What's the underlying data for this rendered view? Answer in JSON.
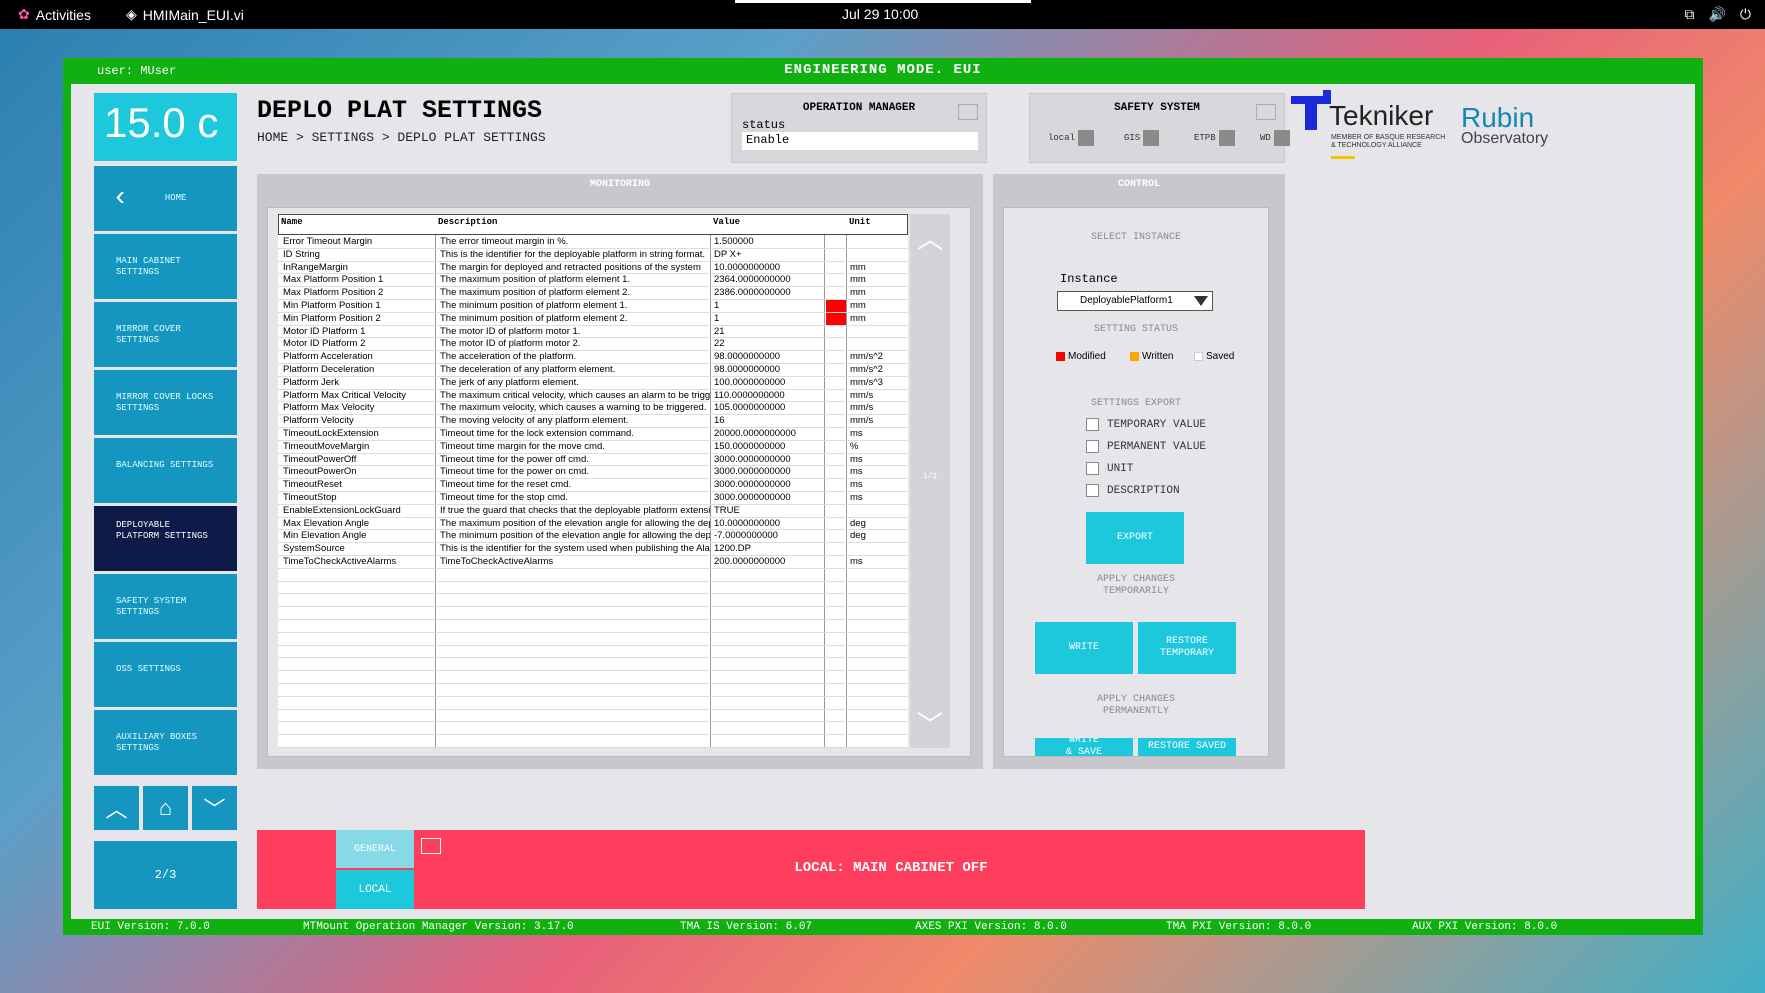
{
  "topbar": {
    "activities": "Activities",
    "app_name": "HMIMain_EUI.vi",
    "clock": "Jul 29  10:00"
  },
  "window": {
    "user": "user: MUser",
    "mode": "ENGINEERING MODE. EUI"
  },
  "sidebar": {
    "temperature": "15.0 c",
    "home_label": "HOME",
    "items": [
      {
        "label": "MAIN CABINET SETTINGS"
      },
      {
        "label": "MIRROR COVER SETTINGS"
      },
      {
        "label": "MIRROR COVER LOCKS SETTINGS"
      },
      {
        "label": "BALANCING SETTINGS"
      },
      {
        "label": "DEPLOYABLE PLATFORM SETTINGS"
      },
      {
        "label": "SAFETY SYSTEM SETTINGS"
      },
      {
        "label": "OSS SETTINGS"
      },
      {
        "label": "AUXILIARY BOXES SETTINGS"
      }
    ],
    "page": "2/3"
  },
  "page": {
    "title": "DEPLO PLAT SETTINGS",
    "breadcrumb": "HOME > SETTINGS > DEPLO PLAT SETTINGS"
  },
  "operation_manager": {
    "title": "OPERATION MANAGER",
    "status_label": "status",
    "status_value": "Enable"
  },
  "safety_system": {
    "title": "SAFETY SYSTEM",
    "indicators": [
      "local",
      "GIS",
      "ETPB",
      "WD"
    ]
  },
  "logos": {
    "tekniker": "Tekniker",
    "tekniker_sub": "MEMBER OF BASQUE RESEARCH & TECHNOLOGY ALLIANCE",
    "rubin_1": "Rubin",
    "rubin_2": "Observatory"
  },
  "monitoring": {
    "title": "MONITORING",
    "columns": [
      "Name",
      "Description",
      "Value",
      "Unit"
    ],
    "page": "1/1",
    "rows": [
      {
        "name": "Error Timeout Margin",
        "desc": "The error timeout margin in %.",
        "value": "1.500000",
        "unit": "",
        "modified": false
      },
      {
        "name": "ID String",
        "desc": "This is the identifier for the deployable platform in string format.",
        "value": "DP X+",
        "unit": "",
        "modified": false
      },
      {
        "name": "InRangeMargin",
        "desc": "The margin for deployed and retracted positions of the system",
        "value": "10.0000000000",
        "unit": "mm",
        "modified": false
      },
      {
        "name": "Max Platform Position 1",
        "desc": "The maximum position of platform element 1.",
        "value": "2364.0000000000",
        "unit": "mm",
        "modified": false
      },
      {
        "name": "Max Platform Position 2",
        "desc": "The maximum position of platform element 2.",
        "value": "2386.0000000000",
        "unit": "mm",
        "modified": false
      },
      {
        "name": "Min Platform Position 1",
        "desc": "The minimum position of platform element 1.",
        "value": "1",
        "unit": "mm",
        "modified": true
      },
      {
        "name": "Min Platform Position 2",
        "desc": "The minimum position of platform element 2.",
        "value": "1",
        "unit": "mm",
        "modified": true
      },
      {
        "name": "Motor ID Platform 1",
        "desc": "The motor ID of platform motor 1.",
        "value": "21",
        "unit": "",
        "modified": false
      },
      {
        "name": "Motor ID Platform 2",
        "desc": "The motor ID of platform motor 2.",
        "value": "22",
        "unit": "",
        "modified": false
      },
      {
        "name": "Platform Acceleration",
        "desc": "The acceleration of the platform.",
        "value": "98.0000000000",
        "unit": "mm/s^2",
        "modified": false
      },
      {
        "name": "Platform Deceleration",
        "desc": "The deceleration of any platform element.",
        "value": "98.0000000000",
        "unit": "mm/s^2",
        "modified": false
      },
      {
        "name": "Platform Jerk",
        "desc": "The jerk of any platform element.",
        "value": "100.0000000000",
        "unit": "mm/s^3",
        "modified": false
      },
      {
        "name": "Platform Max Critical Velocity",
        "desc": "The maximum critical velocity, which causes an alarm to be triggered.",
        "value": "110.0000000000",
        "unit": "mm/s",
        "modified": false
      },
      {
        "name": "Platform Max Velocity",
        "desc": "The maximum velocity, which causes a warning to be triggered.",
        "value": "105.0000000000",
        "unit": "mm/s",
        "modified": false
      },
      {
        "name": "Platform Velocity",
        "desc": "The moving velocity of any platform element.",
        "value": "16",
        "unit": "mm/s",
        "modified": false
      },
      {
        "name": "TimeoutLockExtension",
        "desc": "Timeout time for the lock extension command.",
        "value": "20000.0000000000",
        "unit": "ms",
        "modified": false
      },
      {
        "name": "TimeoutMoveMargin",
        "desc": "Timeout time margin for the move cmd.",
        "value": "150.0000000000",
        "unit": "%",
        "modified": false
      },
      {
        "name": "TimeoutPowerOff",
        "desc": "Timeout time for the power off cmd.",
        "value": "3000.0000000000",
        "unit": "ms",
        "modified": false
      },
      {
        "name": "TimeoutPowerOn",
        "desc": "Timeout time for the power on cmd.",
        "value": "3000.0000000000",
        "unit": "ms",
        "modified": false
      },
      {
        "name": "TimeoutReset",
        "desc": "Timeout time for the reset cmd.",
        "value": "3000.0000000000",
        "unit": "ms",
        "modified": false
      },
      {
        "name": "TimeoutStop",
        "desc": "Timeout time for the stop cmd.",
        "value": "3000.0000000000",
        "unit": "ms",
        "modified": false
      },
      {
        "name": "EnableExtensionLockGuard",
        "desc": "If true the guard that checks that the deployable platform extension is",
        "value": "TRUE",
        "unit": "",
        "modified": false
      },
      {
        "name": "Max Elevation Angle",
        "desc": "The maximum position of the elevation angle for allowing the deployab",
        "value": "10.0000000000",
        "unit": "deg",
        "modified": false
      },
      {
        "name": "Min Elevation Angle",
        "desc": "The minimum position of the elevation angle for allowing the deployab",
        "value": "-7.0000000000",
        "unit": "deg",
        "modified": false
      },
      {
        "name": "SystemSource",
        "desc": "This is the identifier for the system used when publishing the Alarm sou",
        "value": "1200.DP",
        "unit": "",
        "modified": false
      },
      {
        "name": "TimeToCheckActiveAlarms",
        "desc": "TimeToCheckActiveAlarms",
        "value": "200.0000000000",
        "unit": "ms",
        "modified": false
      }
    ]
  },
  "control": {
    "title": "CONTROL",
    "select_instance": "SELECT INSTANCE",
    "instance_label": "Instance",
    "instance_value": "DeployablePlatform1",
    "setting_status": "SETTING STATUS",
    "legend": [
      {
        "label": "Modified",
        "color": "#ff0000"
      },
      {
        "label": "Written",
        "color": "#ffa500"
      },
      {
        "label": "Saved",
        "color": "#ffffff"
      }
    ],
    "settings_export": "SETTINGS EXPORT",
    "export_options": [
      "TEMPORARY VALUE",
      "PERMANENT VALUE",
      "UNIT",
      "DESCRIPTION"
    ],
    "export_button": "EXPORT",
    "apply_temp": "APPLY CHANGES TEMPORARILY",
    "write_button": "WRITE",
    "restore_temp_button": "RESTORE TEMPORARY",
    "apply_perm": "APPLY CHANGES PERMANENTLY",
    "write_save_button": "WRITE & SAVE",
    "restore_saved_button": "RESTORE SAVED"
  },
  "alarm": {
    "tab_general": "GENERAL",
    "tab_local": "LOCAL",
    "message": "LOCAL: MAIN CABINET OFF"
  },
  "footer": {
    "eui": "EUI Version: 7.0.0",
    "opman": "MTMount Operation Manager Version: 3.17.0",
    "tma_is": "TMA IS Version: 6.07",
    "axes_pxi": "AXES PXI Version: 8.0.0",
    "tma_pxi": "TMA PXI Version: 8.0.0",
    "aux_pxi": "AUX PXI Version: 8.0.0"
  },
  "colors": {
    "frame": "#10b010",
    "nav": "#1596c0",
    "nav_active": "#0e1a48",
    "accent": "#1ec8dc",
    "alarm": "#ff3d5c",
    "modified": "#ff0000"
  }
}
